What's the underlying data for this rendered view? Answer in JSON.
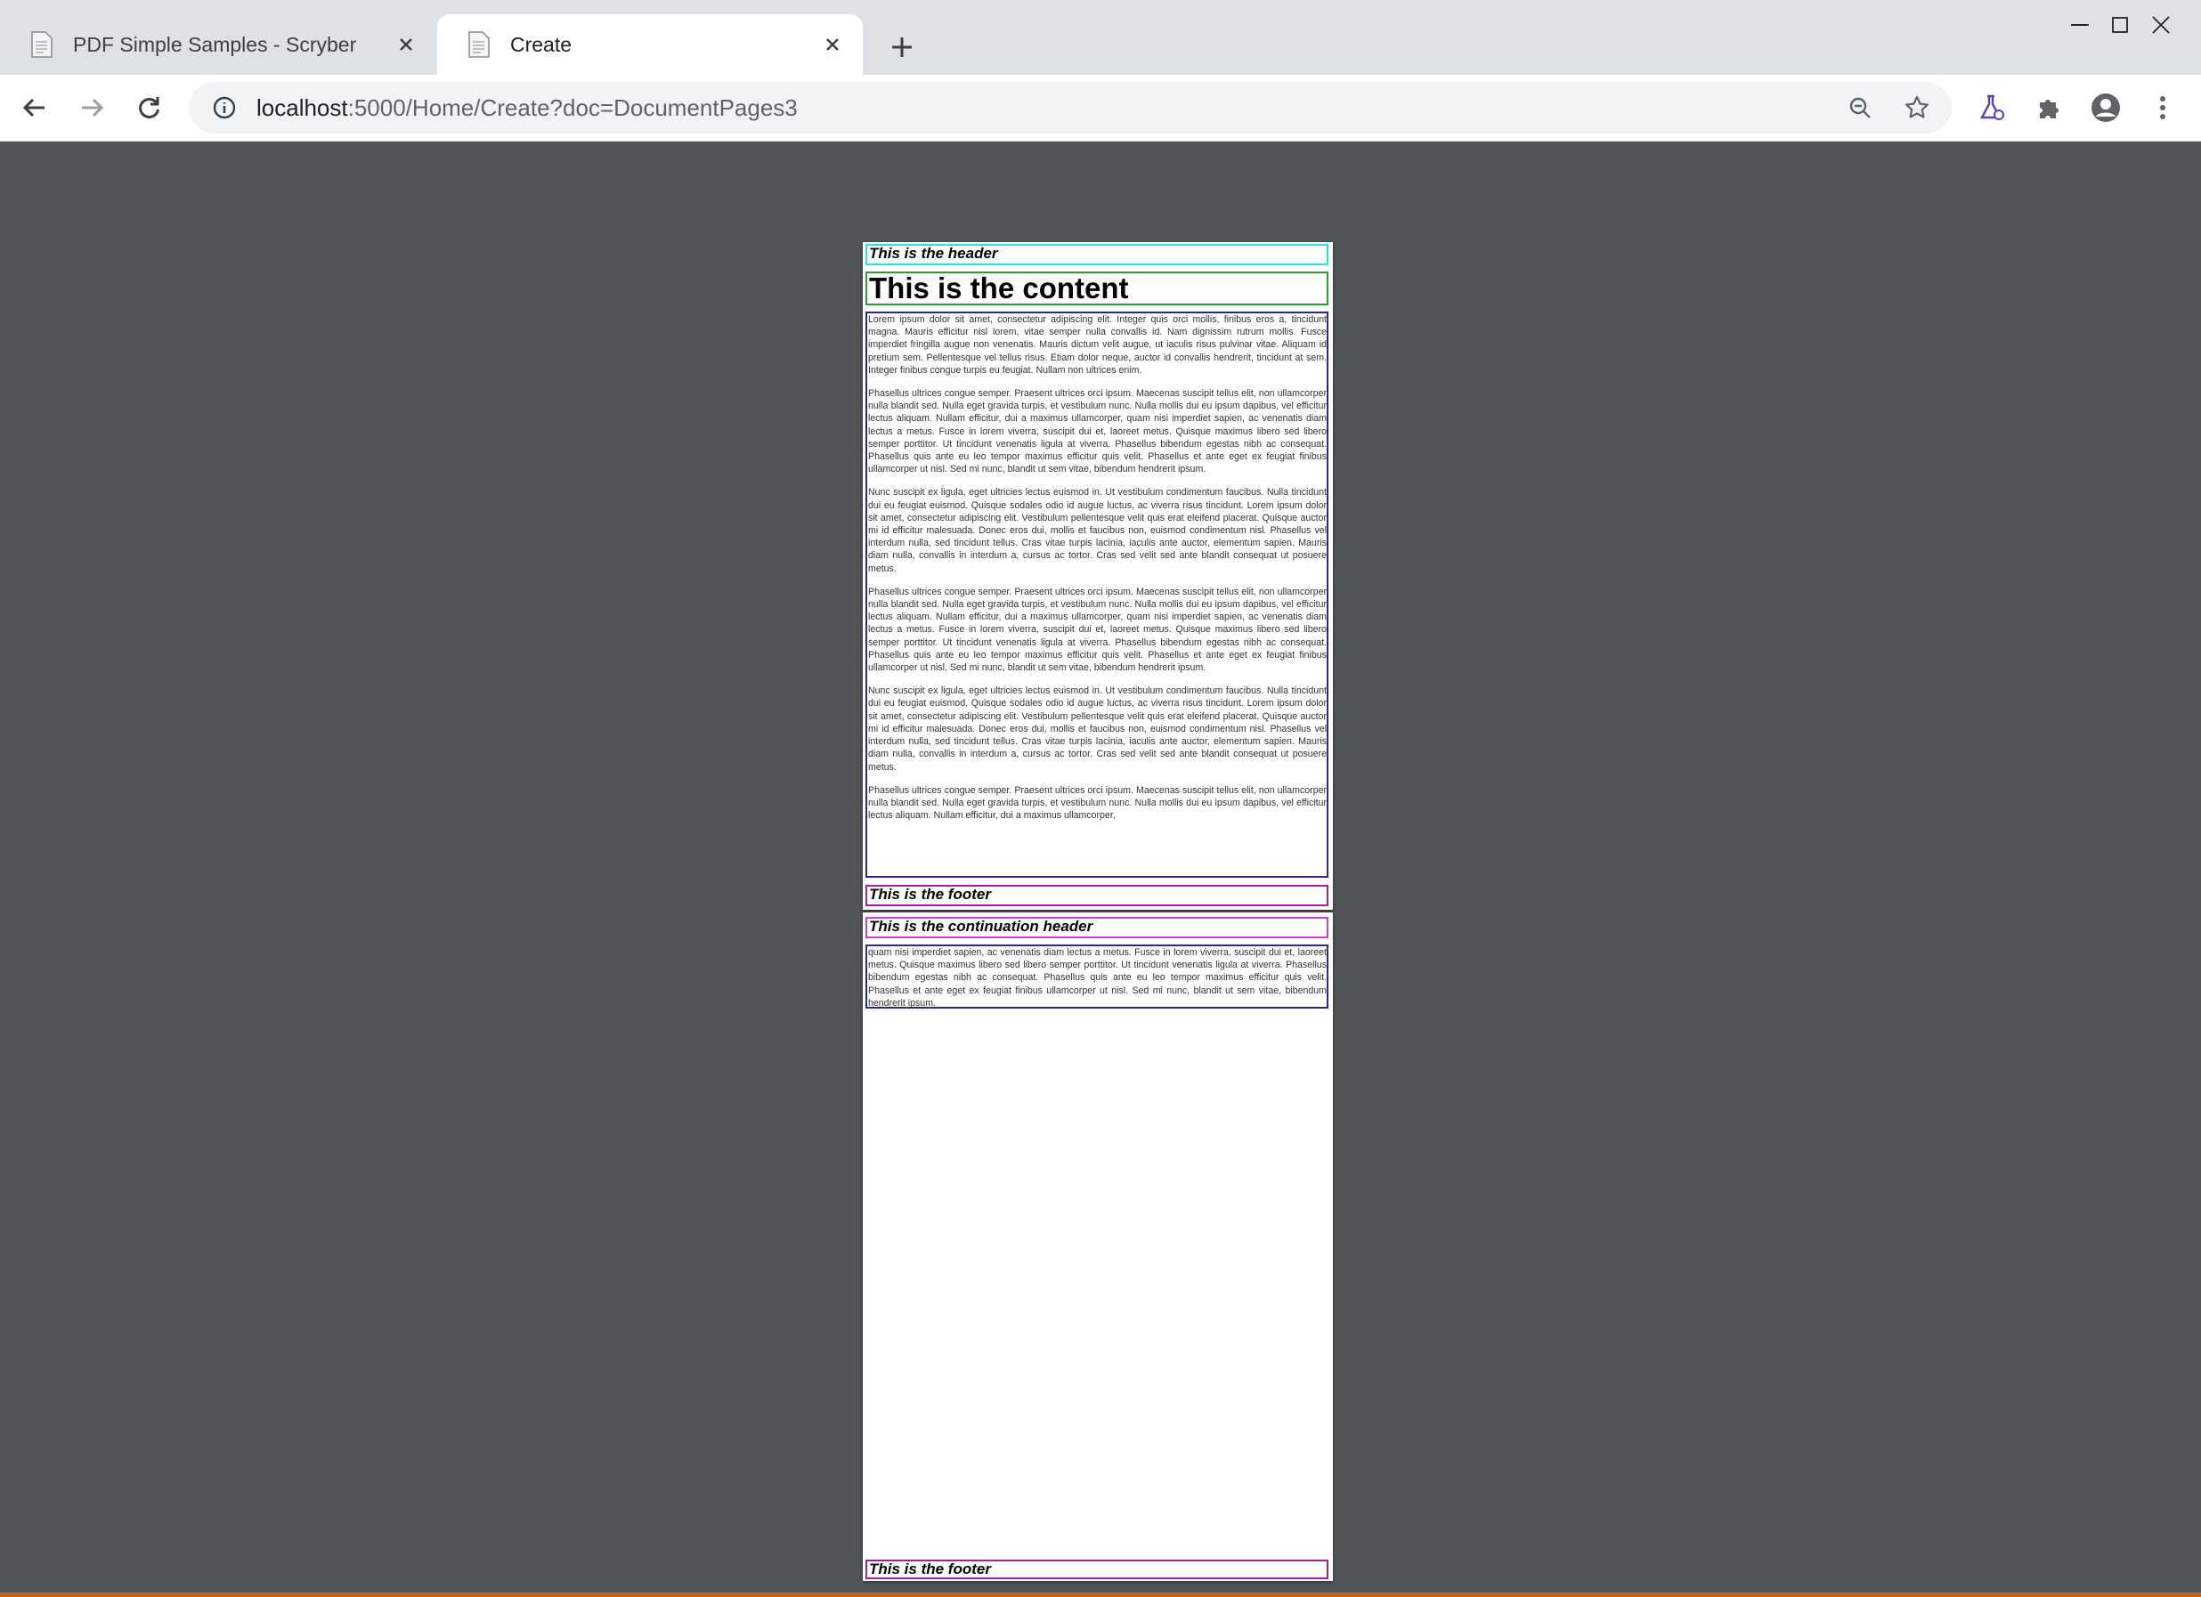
{
  "browser": {
    "tabs": [
      {
        "title": "PDF Simple Samples - Scryber",
        "active": false
      },
      {
        "title": "Create",
        "active": true
      }
    ],
    "address": {
      "host": "localhost",
      "path": ":5000/Home/Create?doc=DocumentPages3"
    }
  },
  "colors": {
    "header_border": "#22e0e8",
    "content_border": "#2ca02c",
    "body_border": "#2a2a8c",
    "footer_border": "#a020a0",
    "cont_header_border": "#d040d0",
    "viewer_bg": "#525659"
  },
  "pdf": {
    "page1": {
      "header": "This is the header",
      "heading": "This is the content",
      "paragraphs": [
        "Lorem ipsum dolor sit amet, consectetur adipiscing elit. Integer quis orci mollis, finibus eros a, tincidunt magna. Mauris efficitur nisl lorem, vitae semper nulla convallis id. Nam dignissim rutrum mollis. Fusce imperdiet fringilla augue non venenatis. Mauris dictum velit augue, ut iaculis risus pulvinar vitae. Aliquam id pretium sem. Pellentesque vel tellus risus. Etiam dolor neque, auctor id convallis hendrerit, tincidunt at sem. Integer finibus congue turpis eu feugiat. Nullam non ultrices enim.",
        "Phasellus ultrices congue semper. Praesent ultrices orci ipsum. Maecenas suscipit tellus elit, non ullamcorper nulla blandit sed. Nulla eget gravida turpis, et vestibulum nunc. Nulla mollis dui eu ipsum dapibus, vel efficitur lectus aliquam. Nullam efficitur, dui a maximus ullamcorper, quam nisi imperdiet sapien, ac venenatis diam lectus a metus. Fusce in lorem viverra, suscipit dui et, laoreet metus. Quisque maximus libero sed libero semper porttitor. Ut tincidunt venenatis ligula at viverra. Phasellus bibendum egestas nibh ac consequat. Phasellus quis ante eu leo tempor maximus efficitur quis velit. Phasellus et ante eget ex feugiat finibus ullamcorper ut nisl. Sed mi nunc, blandit ut sem vitae, bibendum hendrerit ipsum.",
        "Nunc suscipit ex ligula, eget ultricies lectus euismod in. Ut vestibulum condimentum faucibus. Nulla tincidunt dui eu feugiat euismod. Quisque sodales odio id augue luctus, ac viverra risus tincidunt. Lorem ipsum dolor sit amet, consectetur adipiscing elit. Vestibulum pellentesque velit quis erat eleifend placerat. Quisque auctor mi id efficitur malesuada. Donec eros dui, mollis et faucibus non, euismod condimentum nisl. Phasellus vel interdum nulla, sed tincidunt tellus. Cras vitae turpis lacinia, iaculis ante auctor, elementum sapien. Mauris diam nulla, convallis in interdum a, cursus ac tortor. Cras sed velit sed ante blandit consequat ut posuere metus.",
        "Phasellus ultrices congue semper. Praesent ultrices orci ipsum. Maecenas suscipit tellus elit, non ullamcorper nulla blandit sed. Nulla eget gravida turpis, et vestibulum nunc. Nulla mollis dui eu ipsum dapibus, vel efficitur lectus aliquam. Nullam efficitur, dui a maximus ullamcorper, quam nisi imperdiet sapien, ac venenatis diam lectus a metus. Fusce in lorem viverra, suscipit dui et, laoreet metus. Quisque maximus libero sed libero semper porttitor. Ut tincidunt venenatis ligula at viverra. Phasellus bibendum egestas nibh ac consequat. Phasellus quis ante eu leo tempor maximus efficitur quis velit. Phasellus et ante eget ex feugiat finibus ullamcorper ut nisl. Sed mi nunc, blandit ut sem vitae, bibendum hendrerit ipsum.",
        "Nunc suscipit ex ligula, eget ultricies lectus euismod in. Ut vestibulum condimentum faucibus. Nulla tincidunt dui eu feugiat euismod. Quisque sodales odio id augue luctus, ac viverra risus tincidunt. Lorem ipsum dolor sit amet, consectetur adipiscing elit. Vestibulum pellentesque velit quis erat eleifend placerat. Quisque auctor mi id efficitur malesuada. Donec eros dui, mollis et faucibus non, euismod condimentum nisl. Phasellus vel interdum nulla, sed tincidunt tellus. Cras vitae turpis lacinia, iaculis ante auctor, elementum sapien. Mauris diam nulla, convallis in interdum a, cursus ac tortor. Cras sed velit sed ante blandit consequat ut posuere metus.",
        "Phasellus ultrices congue semper. Praesent ultrices orci ipsum. Maecenas suscipit tellus elit, non ullamcorper nulla blandit sed. Nulla eget gravida turpis, et vestibulum nunc. Nulla mollis dui eu ipsum dapibus, vel efficitur lectus aliquam. Nullam efficitur, dui a maximus ullamcorper,"
      ],
      "footer": "This is the footer"
    },
    "page2": {
      "header": "This is the continuation header",
      "paragraphs": [
        "quam nisi imperdiet sapien, ac venenatis diam lectus a metus. Fusce in lorem viverra, suscipit dui et, laoreet metus. Quisque maximus libero sed libero semper porttitor. Ut tincidunt venenatis ligula at viverra. Phasellus bibendum egestas nibh ac consequat. Phasellus quis ante eu leo tempor maximus efficitur quis velit. Phasellus et ante eget ex feugiat finibus ullamcorper ut nisl. Sed mi nunc, blandit ut sem vitae, bibendum hendrerit ipsum."
      ],
      "footer": "This is the footer"
    }
  }
}
